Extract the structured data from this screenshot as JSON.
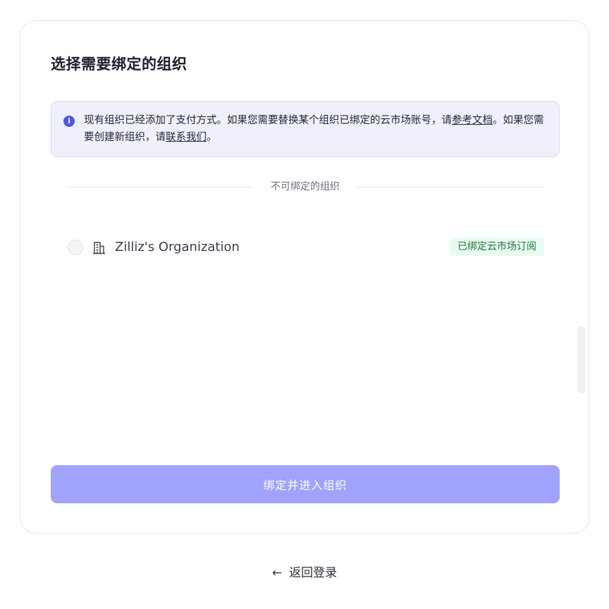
{
  "modal": {
    "title": "选择需要绑定的组织",
    "alert": {
      "icon": "info-icon",
      "text_before": "现有组织已经添加了支付方式。如果您需要替换某个组织已绑定的云市场账号，请",
      "docs_link": "参考文档",
      "text_middle": "。如果您需要创建新组织，请",
      "contact_link": "联系我们",
      "text_after": "。"
    },
    "divider_label": "不可绑定的组织",
    "organizations": [
      {
        "name": "Zilliz's Organization",
        "icon": "building-icon",
        "badge": "已绑定云市场订阅",
        "selected": false
      }
    ],
    "submit_label": "绑定并进入组织"
  },
  "back_link": {
    "icon": "arrow-left-icon",
    "label": "返回登录"
  },
  "colors": {
    "accent": "#4f55f1",
    "button_disabled": "#a0a2fc",
    "alert_bg": "#f0f0fd",
    "badge_bg": "#eafaf0",
    "badge_text": "#1d7a3e"
  }
}
